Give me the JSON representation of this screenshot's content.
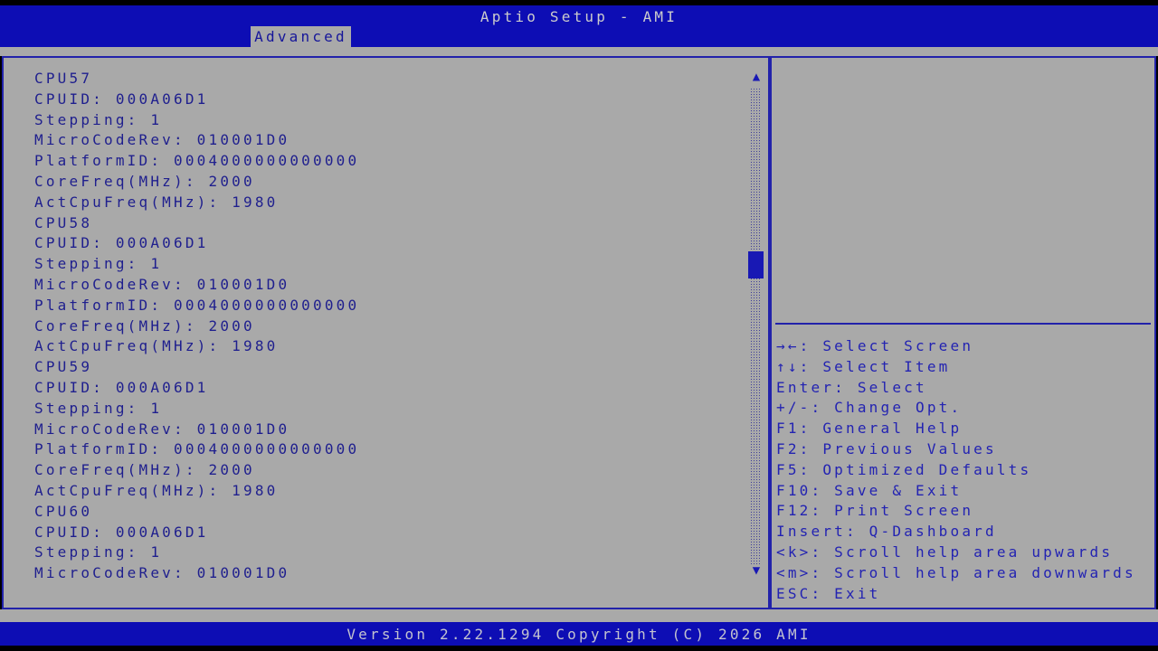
{
  "window": {
    "top_title": "Aptio Setup - AMI"
  },
  "header": {
    "tabs": [
      {
        "label": "Advanced",
        "active": true
      }
    ]
  },
  "main": {
    "lines": [
      "CPU57",
      "CPUID: 000A06D1",
      "Stepping: 1",
      "MicroCodeRev: 010001D0",
      "PlatformID: 0004000000000000",
      "CoreFreq(MHz): 2000",
      "ActCpuFreq(MHz): 1980",
      "CPU58",
      "CPUID: 000A06D1",
      "Stepping: 1",
      "MicroCodeRev: 010001D0",
      "PlatformID: 0004000000000000",
      "CoreFreq(MHz): 2000",
      "ActCpuFreq(MHz): 1980",
      "CPU59",
      "CPUID: 000A06D1",
      "Stepping: 1",
      "MicroCodeRev: 010001D0",
      "PlatformID: 0004000000000000",
      "CoreFreq(MHz): 2000",
      "ActCpuFreq(MHz): 1980",
      "CPU60",
      "CPUID: 000A06D1",
      "Stepping: 1",
      "MicroCodeRev: 010001D0"
    ]
  },
  "scrollbar": {
    "up_icon": "▲",
    "down_icon": "▼"
  },
  "help": {
    "keys": [
      "→←: Select Screen",
      "↑↓: Select Item",
      "Enter: Select",
      "+/-: Change Opt.",
      "F1: General Help",
      "F2: Previous Values",
      "F5: Optimized Defaults",
      "F10: Save & Exit",
      "F12: Print Screen",
      "Insert: Q-Dashboard",
      "<k>: Scroll help area upwards",
      "<m>: Scroll help area downwards",
      "ESC: Exit"
    ]
  },
  "footer": {
    "version_text": "Version 2.22.1294 Copyright (C) 2026 AMI"
  },
  "colors": {
    "header_blue": "#0d0db4",
    "background_gray": "#a9a9a9",
    "border_blue": "#2222aa",
    "content_text": "#1f1f8e",
    "help_text": "#2323b2",
    "title_text": "#cccccc",
    "footer_text": "#c3c3cf",
    "tab_text": "#16169a",
    "thumb_blue": "#1818b4"
  }
}
